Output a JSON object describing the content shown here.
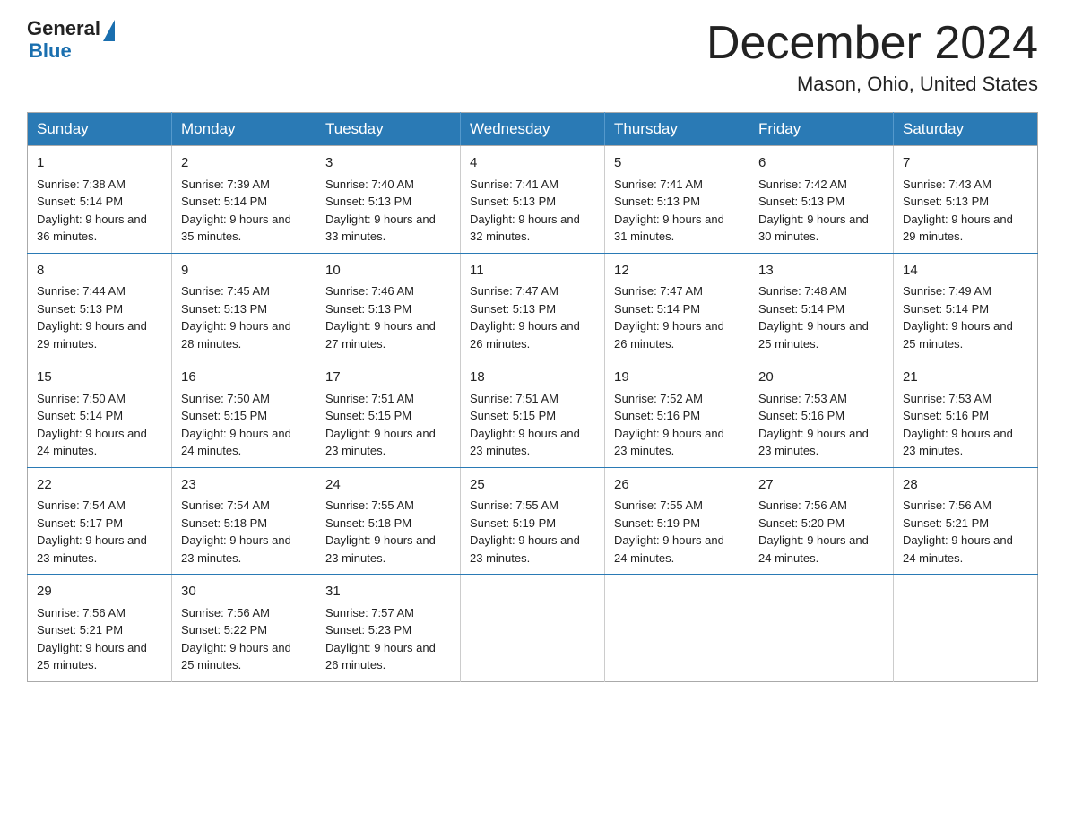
{
  "logo": {
    "general": "General",
    "blue": "Blue",
    "triangle": "▶"
  },
  "title": "December 2024",
  "subtitle": "Mason, Ohio, United States",
  "days_of_week": [
    "Sunday",
    "Monday",
    "Tuesday",
    "Wednesday",
    "Thursday",
    "Friday",
    "Saturday"
  ],
  "weeks": [
    [
      {
        "day": "1",
        "sunrise": "Sunrise: 7:38 AM",
        "sunset": "Sunset: 5:14 PM",
        "daylight": "Daylight: 9 hours and 36 minutes."
      },
      {
        "day": "2",
        "sunrise": "Sunrise: 7:39 AM",
        "sunset": "Sunset: 5:14 PM",
        "daylight": "Daylight: 9 hours and 35 minutes."
      },
      {
        "day": "3",
        "sunrise": "Sunrise: 7:40 AM",
        "sunset": "Sunset: 5:13 PM",
        "daylight": "Daylight: 9 hours and 33 minutes."
      },
      {
        "day": "4",
        "sunrise": "Sunrise: 7:41 AM",
        "sunset": "Sunset: 5:13 PM",
        "daylight": "Daylight: 9 hours and 32 minutes."
      },
      {
        "day": "5",
        "sunrise": "Sunrise: 7:41 AM",
        "sunset": "Sunset: 5:13 PM",
        "daylight": "Daylight: 9 hours and 31 minutes."
      },
      {
        "day": "6",
        "sunrise": "Sunrise: 7:42 AM",
        "sunset": "Sunset: 5:13 PM",
        "daylight": "Daylight: 9 hours and 30 minutes."
      },
      {
        "day": "7",
        "sunrise": "Sunrise: 7:43 AM",
        "sunset": "Sunset: 5:13 PM",
        "daylight": "Daylight: 9 hours and 29 minutes."
      }
    ],
    [
      {
        "day": "8",
        "sunrise": "Sunrise: 7:44 AM",
        "sunset": "Sunset: 5:13 PM",
        "daylight": "Daylight: 9 hours and 29 minutes."
      },
      {
        "day": "9",
        "sunrise": "Sunrise: 7:45 AM",
        "sunset": "Sunset: 5:13 PM",
        "daylight": "Daylight: 9 hours and 28 minutes."
      },
      {
        "day": "10",
        "sunrise": "Sunrise: 7:46 AM",
        "sunset": "Sunset: 5:13 PM",
        "daylight": "Daylight: 9 hours and 27 minutes."
      },
      {
        "day": "11",
        "sunrise": "Sunrise: 7:47 AM",
        "sunset": "Sunset: 5:13 PM",
        "daylight": "Daylight: 9 hours and 26 minutes."
      },
      {
        "day": "12",
        "sunrise": "Sunrise: 7:47 AM",
        "sunset": "Sunset: 5:14 PM",
        "daylight": "Daylight: 9 hours and 26 minutes."
      },
      {
        "day": "13",
        "sunrise": "Sunrise: 7:48 AM",
        "sunset": "Sunset: 5:14 PM",
        "daylight": "Daylight: 9 hours and 25 minutes."
      },
      {
        "day": "14",
        "sunrise": "Sunrise: 7:49 AM",
        "sunset": "Sunset: 5:14 PM",
        "daylight": "Daylight: 9 hours and 25 minutes."
      }
    ],
    [
      {
        "day": "15",
        "sunrise": "Sunrise: 7:50 AM",
        "sunset": "Sunset: 5:14 PM",
        "daylight": "Daylight: 9 hours and 24 minutes."
      },
      {
        "day": "16",
        "sunrise": "Sunrise: 7:50 AM",
        "sunset": "Sunset: 5:15 PM",
        "daylight": "Daylight: 9 hours and 24 minutes."
      },
      {
        "day": "17",
        "sunrise": "Sunrise: 7:51 AM",
        "sunset": "Sunset: 5:15 PM",
        "daylight": "Daylight: 9 hours and 23 minutes."
      },
      {
        "day": "18",
        "sunrise": "Sunrise: 7:51 AM",
        "sunset": "Sunset: 5:15 PM",
        "daylight": "Daylight: 9 hours and 23 minutes."
      },
      {
        "day": "19",
        "sunrise": "Sunrise: 7:52 AM",
        "sunset": "Sunset: 5:16 PM",
        "daylight": "Daylight: 9 hours and 23 minutes."
      },
      {
        "day": "20",
        "sunrise": "Sunrise: 7:53 AM",
        "sunset": "Sunset: 5:16 PM",
        "daylight": "Daylight: 9 hours and 23 minutes."
      },
      {
        "day": "21",
        "sunrise": "Sunrise: 7:53 AM",
        "sunset": "Sunset: 5:16 PM",
        "daylight": "Daylight: 9 hours and 23 minutes."
      }
    ],
    [
      {
        "day": "22",
        "sunrise": "Sunrise: 7:54 AM",
        "sunset": "Sunset: 5:17 PM",
        "daylight": "Daylight: 9 hours and 23 minutes."
      },
      {
        "day": "23",
        "sunrise": "Sunrise: 7:54 AM",
        "sunset": "Sunset: 5:18 PM",
        "daylight": "Daylight: 9 hours and 23 minutes."
      },
      {
        "day": "24",
        "sunrise": "Sunrise: 7:55 AM",
        "sunset": "Sunset: 5:18 PM",
        "daylight": "Daylight: 9 hours and 23 minutes."
      },
      {
        "day": "25",
        "sunrise": "Sunrise: 7:55 AM",
        "sunset": "Sunset: 5:19 PM",
        "daylight": "Daylight: 9 hours and 23 minutes."
      },
      {
        "day": "26",
        "sunrise": "Sunrise: 7:55 AM",
        "sunset": "Sunset: 5:19 PM",
        "daylight": "Daylight: 9 hours and 24 minutes."
      },
      {
        "day": "27",
        "sunrise": "Sunrise: 7:56 AM",
        "sunset": "Sunset: 5:20 PM",
        "daylight": "Daylight: 9 hours and 24 minutes."
      },
      {
        "day": "28",
        "sunrise": "Sunrise: 7:56 AM",
        "sunset": "Sunset: 5:21 PM",
        "daylight": "Daylight: 9 hours and 24 minutes."
      }
    ],
    [
      {
        "day": "29",
        "sunrise": "Sunrise: 7:56 AM",
        "sunset": "Sunset: 5:21 PM",
        "daylight": "Daylight: 9 hours and 25 minutes."
      },
      {
        "day": "30",
        "sunrise": "Sunrise: 7:56 AM",
        "sunset": "Sunset: 5:22 PM",
        "daylight": "Daylight: 9 hours and 25 minutes."
      },
      {
        "day": "31",
        "sunrise": "Sunrise: 7:57 AM",
        "sunset": "Sunset: 5:23 PM",
        "daylight": "Daylight: 9 hours and 26 minutes."
      },
      null,
      null,
      null,
      null
    ]
  ]
}
